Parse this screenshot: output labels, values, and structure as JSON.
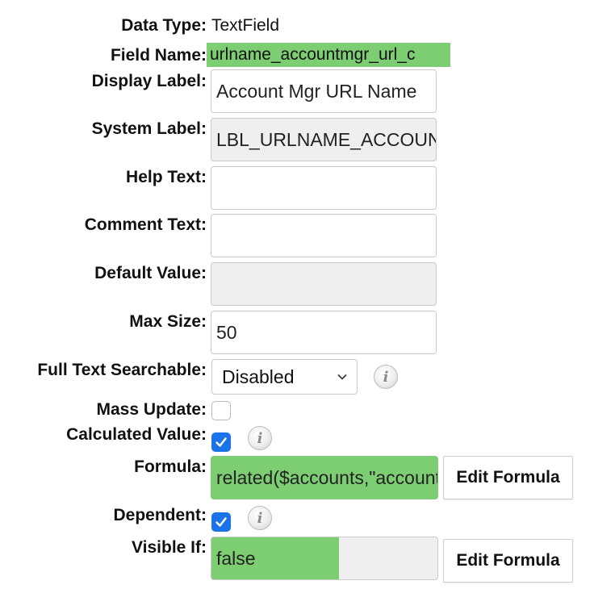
{
  "data_type": {
    "label": "Data Type:",
    "value": "TextField"
  },
  "field_name": {
    "label": "Field Name:",
    "value": "urlname_accountmgr_url_c"
  },
  "display_label": {
    "label": "Display Label:",
    "value": "Account Mgr URL Name"
  },
  "system_label": {
    "label": "System Label:",
    "value": "LBL_URLNAME_ACCOUNTMGR_URL"
  },
  "help_text": {
    "label": "Help Text:",
    "value": ""
  },
  "comment_text": {
    "label": "Comment Text:",
    "value": ""
  },
  "default_value": {
    "label": "Default Value:",
    "value": ""
  },
  "max_size": {
    "label": "Max Size:",
    "value": "50"
  },
  "full_text_searchable": {
    "label": "Full Text Searchable:",
    "selected": "Disabled",
    "info_icon": "info-icon"
  },
  "mass_update": {
    "label": "Mass Update:",
    "checked": false
  },
  "calculated_value": {
    "label": "Calculated Value:",
    "checked": true,
    "info_icon": "info-icon"
  },
  "formula": {
    "label": "Formula:",
    "value": "related($accounts,\"account_manager_url_c\")",
    "button": "Edit Formula"
  },
  "dependent": {
    "label": "Dependent:",
    "checked": true,
    "info_icon": "info-icon"
  },
  "visible_if": {
    "label": "Visible If:",
    "value": "false",
    "button": "Edit Formula"
  },
  "colors": {
    "highlight": "#7dcd72",
    "checkbox": "#1a73e8",
    "disabled_bg": "#efefef"
  }
}
